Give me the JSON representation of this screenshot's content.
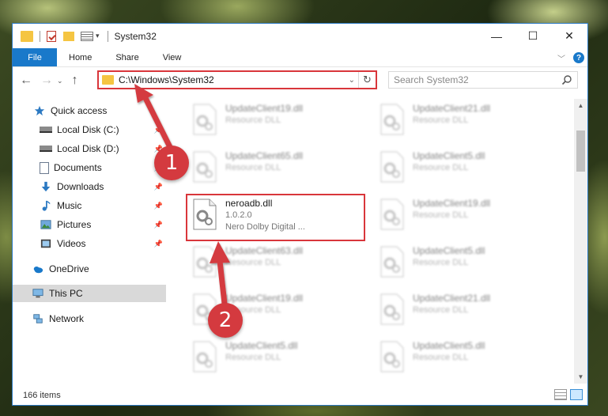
{
  "window": {
    "title": "System32",
    "controls": {
      "minimize": "—",
      "maximize": "☐",
      "close": "✕"
    }
  },
  "ribbon": {
    "tabs": [
      {
        "label": "File"
      },
      {
        "label": "Home"
      },
      {
        "label": "Share"
      },
      {
        "label": "View"
      }
    ],
    "help": "?"
  },
  "address_bar": {
    "path": "C:\\Windows\\System32",
    "search_placeholder": "Search System32"
  },
  "sidebar": {
    "items": [
      {
        "label": "Quick access",
        "icon": "star-icon",
        "pinned": false
      },
      {
        "label": "Local Disk (C:)",
        "icon": "drive-icon",
        "pinned": true
      },
      {
        "label": "Local Disk (D:)",
        "icon": "drive-icon",
        "pinned": true
      },
      {
        "label": "Documents",
        "icon": "documents-icon",
        "pinned": true
      },
      {
        "label": "Downloads",
        "icon": "download-icon",
        "pinned": true
      },
      {
        "label": "Music",
        "icon": "music-icon",
        "pinned": true
      },
      {
        "label": "Pictures",
        "icon": "pictures-icon",
        "pinned": true
      },
      {
        "label": "Videos",
        "icon": "videos-icon",
        "pinned": true
      },
      {
        "label": "OneDrive",
        "icon": "cloud-icon",
        "pinned": false
      },
      {
        "label": "This PC",
        "icon": "computer-icon",
        "pinned": false,
        "selected": true
      },
      {
        "label": "Network",
        "icon": "network-icon",
        "pinned": false
      }
    ]
  },
  "files": {
    "left_column": [
      {
        "name": "UpdateClient19.dll",
        "type": "Resource DLL"
      },
      {
        "name": "UpdateClient65.dll",
        "type": "Resource DLL"
      },
      {
        "name": "neroadb.dll",
        "version": "1.0.2.0",
        "description": "Nero Dolby Digital ...",
        "highlighted": true
      },
      {
        "name": "UpdateClient63.dll",
        "type": "Resource DLL"
      },
      {
        "name": "UpdateClient19.dll",
        "type": "Resource DLL"
      },
      {
        "name": "UpdateClient5.dll",
        "type": "Resource DLL"
      }
    ],
    "right_column": [
      {
        "name": "UpdateClient21.dll",
        "type": "Resource DLL"
      },
      {
        "name": "UpdateClient5.dll",
        "type": "Resource DLL"
      },
      {
        "name": "UpdateClient19.dll",
        "type": "Resource DLL"
      },
      {
        "name": "UpdateClient5.dll",
        "type": "Resource DLL"
      },
      {
        "name": "UpdateClient21.dll",
        "type": "Resource DLL"
      },
      {
        "name": "UpdateClient5.dll",
        "type": "Resource DLL"
      }
    ]
  },
  "status": {
    "item_count": "166 items"
  },
  "callouts": [
    {
      "label": "1"
    },
    {
      "label": "2"
    }
  ],
  "colors": {
    "accent": "#1979ca",
    "highlight": "#d9363b",
    "callout": "#d43a3f"
  }
}
